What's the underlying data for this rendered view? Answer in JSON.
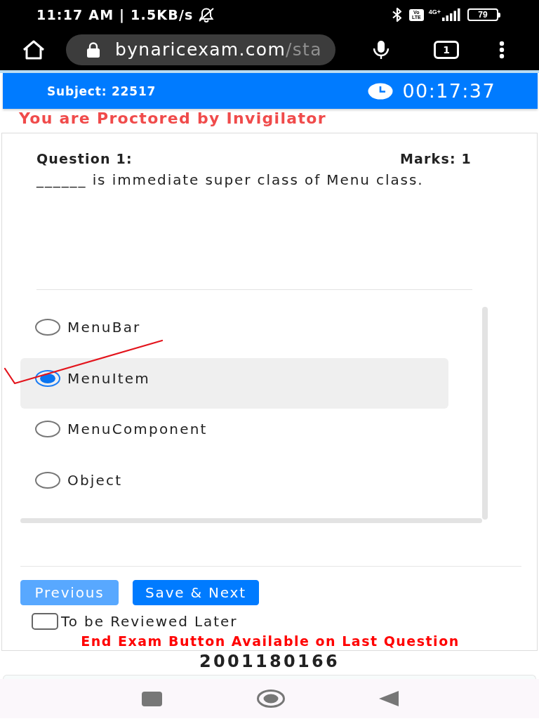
{
  "status_bar": {
    "time_speed": "11:17 AM | 1.5KB/s",
    "volte": [
      "Vo",
      "LTE"
    ],
    "network": "4G+",
    "battery": "79"
  },
  "browser": {
    "url_domain": "bynaricexam.com",
    "url_path": "/sta",
    "tab_count": "1"
  },
  "header": {
    "subject": "Subject: 22517",
    "timer": "00:17:37"
  },
  "proctor_notice": "You are Proctored by Invigilator",
  "question": {
    "title": "Question 1:",
    "marks": "Marks: 1",
    "text": "______ is immediate super class of Menu class."
  },
  "options": [
    {
      "label": "MenuBar",
      "selected": false
    },
    {
      "label": "MenuItem",
      "selected": true
    },
    {
      "label": "MenuComponent",
      "selected": false
    },
    {
      "label": "Object",
      "selected": false
    }
  ],
  "previous_button": {
    "label": "Previous",
    "disabled": true
  },
  "next_button": {
    "label": "Save & Next",
    "disabled": false
  },
  "review": {
    "label": "To be Reviewed Later",
    "checked": false
  },
  "end_notice": "End Exam Button Available on Last Question",
  "candidate_id": "2001180166"
}
